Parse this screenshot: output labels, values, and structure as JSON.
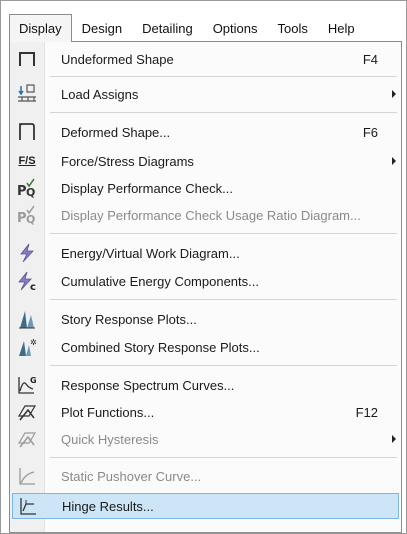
{
  "menubar": {
    "items": [
      {
        "label": "Display",
        "active": true
      },
      {
        "label": "Design"
      },
      {
        "label": "Detailing"
      },
      {
        "label": "Options"
      },
      {
        "label": "Tools"
      },
      {
        "label": "Help"
      }
    ]
  },
  "dropdown": {
    "items": [
      {
        "label": "Undeformed Shape",
        "shortcut": "F4",
        "icon": "undeformed-shape-icon",
        "icon_text": "Π"
      },
      {
        "label": "Load Assigns",
        "submenu": true,
        "icon": "load-assigns-icon"
      },
      {
        "label": "Deformed Shape...",
        "shortcut": "F6",
        "icon": "deformed-shape-icon"
      },
      {
        "label": "Force/Stress Diagrams",
        "submenu": true,
        "icon": "force-stress-icon",
        "icon_text": "F/S"
      },
      {
        "label": "Display Performance Check...",
        "icon": "performance-check-icon",
        "icon_text": "PQ"
      },
      {
        "label": "Display Performance Check Usage Ratio Diagram...",
        "disabled": true,
        "icon": "usage-ratio-icon",
        "icon_text": "PQ"
      },
      {
        "label": "Energy/Virtual Work Diagram...",
        "icon": "energy-diagram-icon"
      },
      {
        "label": "Cumulative Energy Components...",
        "icon": "cumulative-energy-icon",
        "icon_text": "c"
      },
      {
        "label": "Story Response Plots...",
        "icon": "story-response-icon"
      },
      {
        "label": "Combined Story Response Plots...",
        "icon": "combined-story-response-icon"
      },
      {
        "label": "Response Spectrum Curves...",
        "icon": "response-spectrum-icon",
        "icon_text": "G"
      },
      {
        "label": "Plot Functions...",
        "shortcut": "F12",
        "icon": "plot-functions-icon"
      },
      {
        "label": "Quick Hysteresis",
        "submenu": true,
        "disabled": true,
        "icon": "quick-hysteresis-icon"
      },
      {
        "label": "Static Pushover Curve...",
        "disabled": true,
        "icon": "pushover-curve-icon"
      },
      {
        "label": "Hinge Results...",
        "selected": true,
        "icon": "hinge-results-icon"
      }
    ]
  }
}
